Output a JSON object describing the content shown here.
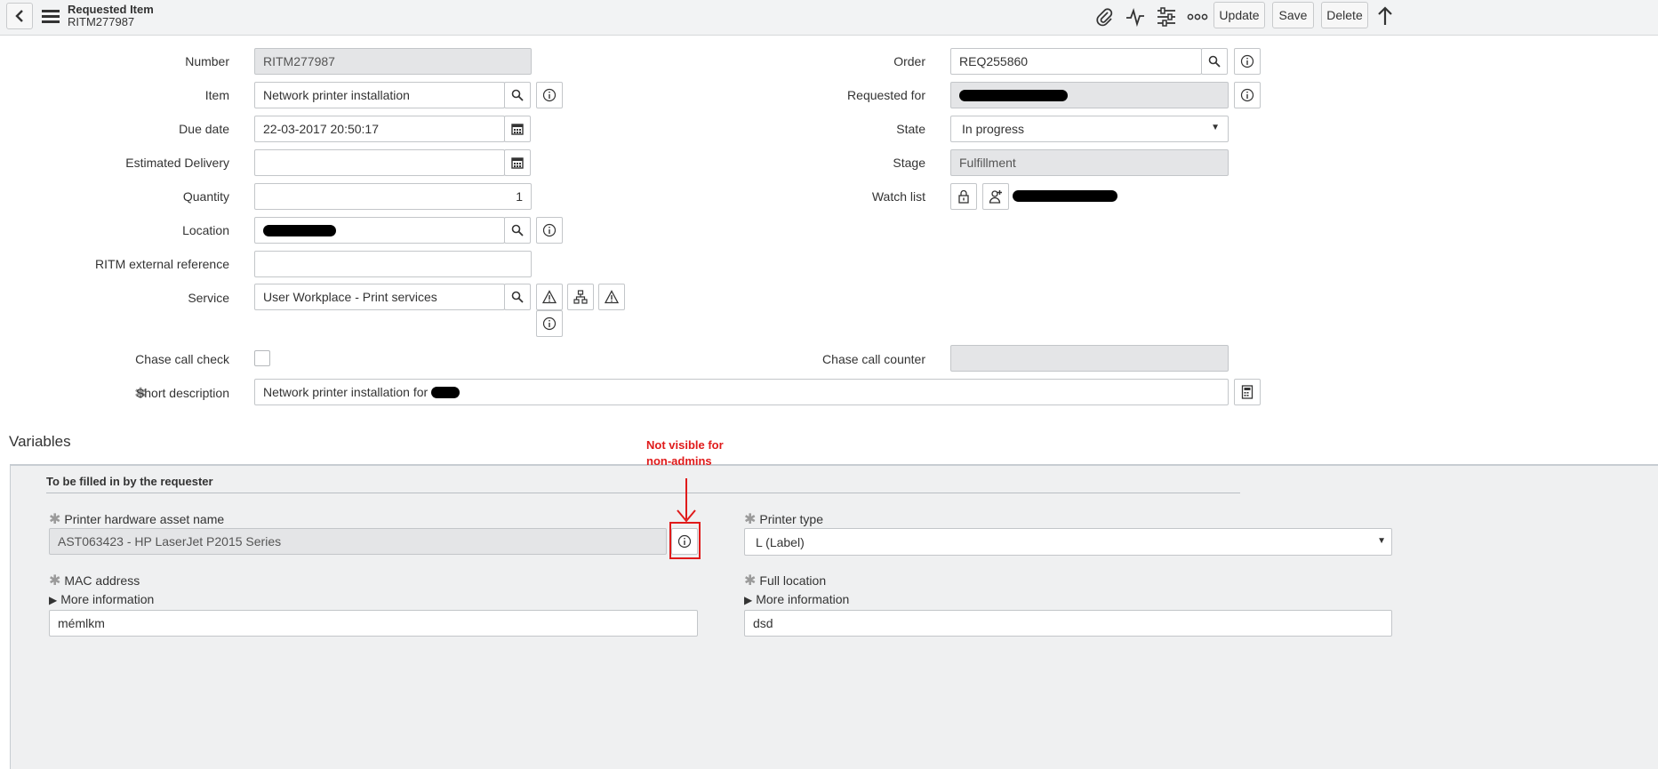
{
  "header": {
    "title": "Requested Item",
    "subtitle": "RITM277987",
    "buttons": {
      "update": "Update",
      "save": "Save",
      "delete": "Delete"
    }
  },
  "form": {
    "number": {
      "label": "Number",
      "value": "RITM277987"
    },
    "item": {
      "label": "Item",
      "value": "Network printer installation"
    },
    "due_date": {
      "label": "Due date",
      "value": "22-03-2017 20:50:17"
    },
    "estimated_delivery": {
      "label": "Estimated Delivery",
      "value": ""
    },
    "quantity": {
      "label": "Quantity",
      "value": "1"
    },
    "location": {
      "label": "Location"
    },
    "ritm_external_reference": {
      "label": "RITM external reference",
      "value": ""
    },
    "service": {
      "label": "Service",
      "value": "User Workplace - Print services"
    },
    "chase_call_check": {
      "label": "Chase call check"
    },
    "short_description": {
      "label": "Short description",
      "value": "Network printer installation for"
    },
    "order": {
      "label": "Order",
      "value": "REQ255860"
    },
    "requested_for": {
      "label": "Requested for"
    },
    "state": {
      "label": "State",
      "value": "In progress"
    },
    "stage": {
      "label": "Stage",
      "value": "Fulfillment"
    },
    "watch_list": {
      "label": "Watch list"
    },
    "chase_call_counter": {
      "label": "Chase call counter",
      "value": ""
    }
  },
  "variables": {
    "title": "Variables",
    "section_title": "To be filled in by the requester",
    "printer_hardware_asset_name": {
      "label": "Printer hardware asset name",
      "value": "AST063423 - HP LaserJet P2015 Series"
    },
    "printer_type": {
      "label": "Printer type",
      "value": "L (Label)"
    },
    "mac_address": {
      "label": "MAC address",
      "more_info": "More information",
      "value": "mémlkm"
    },
    "full_location": {
      "label": "Full location",
      "more_info": "More information",
      "value": "dsd"
    }
  },
  "annotation": {
    "line1": "Not visible for",
    "line2": "non-admins"
  },
  "colors": {
    "annotation": "#e01b1b",
    "header_bg": "#f2f3f4",
    "readonly_bg": "#e4e5e7",
    "variables_bg": "#eff0f1"
  },
  "icons": [
    "back-icon",
    "menu-icon",
    "paperclip-icon",
    "activity-icon",
    "settings-sliders-icon",
    "more-icon",
    "scroll-up-icon",
    "search-icon",
    "info-icon",
    "calendar-icon",
    "warning-icon",
    "hierarchy-icon",
    "lock-icon",
    "add-person-icon",
    "template-icon",
    "expand-triangle-icon",
    "required-star-icon",
    "dropdown-arrow-icon"
  ]
}
